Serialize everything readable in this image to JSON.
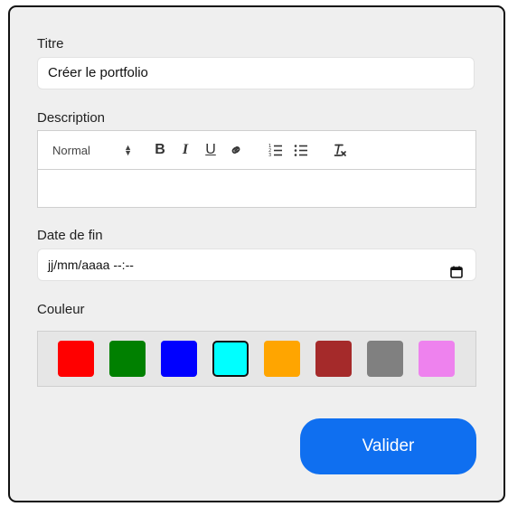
{
  "form": {
    "title_label": "Titre",
    "title_value": "Créer le portfolio",
    "description_label": "Description",
    "editor": {
      "format_select": "Normal",
      "tools": [
        "bold-icon",
        "italic-icon",
        "underline-icon",
        "link-icon",
        "ordered-list-icon",
        "bullet-list-icon",
        "clear-format-icon"
      ],
      "content": ""
    },
    "end_date_label": "Date de fin",
    "end_date_placeholder": "jj/mm/aaaa --:--",
    "color_label": "Couleur",
    "colors": [
      {
        "hex": "#ff0000",
        "selected": false
      },
      {
        "hex": "#008000",
        "selected": false
      },
      {
        "hex": "#0000ff",
        "selected": false
      },
      {
        "hex": "#00ffff",
        "selected": true
      },
      {
        "hex": "#ffa500",
        "selected": false
      },
      {
        "hex": "#a52a2a",
        "selected": false
      },
      {
        "hex": "#808080",
        "selected": false
      },
      {
        "hex": "#ee82ee",
        "selected": false
      }
    ],
    "submit_label": "Valider",
    "accent": "#0f6ff0"
  }
}
